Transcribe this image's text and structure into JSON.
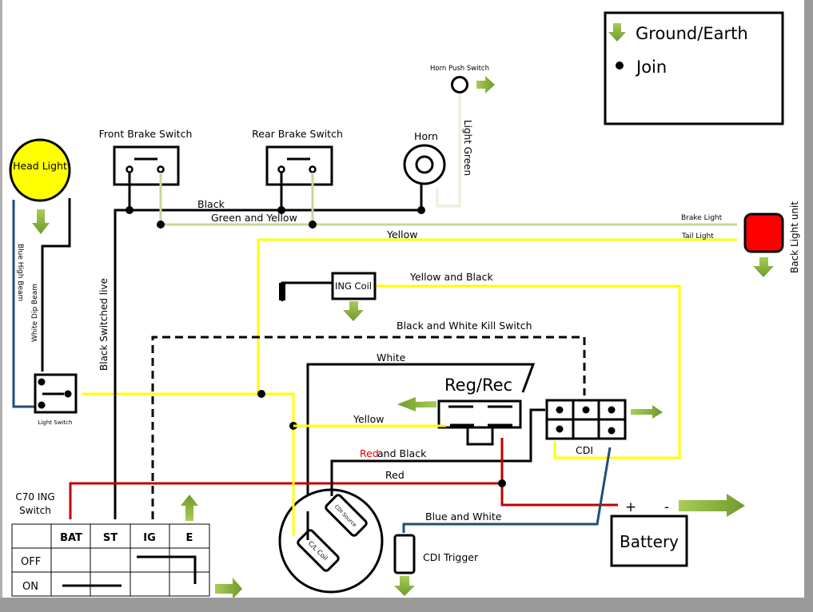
{
  "legend": {
    "items": [
      {
        "icon": "ground-arrow-icon",
        "label": "Ground/Earth"
      },
      {
        "icon": "join-dot-icon",
        "label": "Join"
      }
    ]
  },
  "components": {
    "head_light": "Head Light",
    "light_switch": "Light Switch",
    "front_brake_switch": "Front Brake Switch",
    "rear_brake_switch": "Rear Brake Switch",
    "horn": "Horn",
    "horn_push_switch": "Horn Push Switch",
    "back_light_unit": "Back Light unit",
    "ing_coil": "ING Coil",
    "reg_rec": "Reg/Rec",
    "cdi": "CDI",
    "battery": "Battery",
    "battery_plus": "+",
    "battery_minus": "-",
    "cdi_trigger": "CDI Trigger",
    "cl_coil": "C/L Coil",
    "cdi_source": "CDI Source",
    "ign_switch": "C70 ING Switch",
    "ign_switch_line1": "C70 ING",
    "ign_switch_line2": "Switch"
  },
  "wires": {
    "blue_high_beam": "Blue High Beam",
    "white_dip_beam": "White Dip Beam",
    "black_switched_live": "Black Switched live",
    "black": "Black",
    "green_and_yellow": "Green and Yellow",
    "light_green": "Light Green",
    "brake_light": "Brake Light",
    "tail_light": "Tail Light",
    "yellow_top": "Yellow",
    "yellow_and_black": "Yellow and Black",
    "kill_switch": "Black and White Kill Switch",
    "white": "White",
    "yellow_mid": "Yellow",
    "red_and_black_red": "Red",
    "red_and_black_rest": " and Black",
    "red": "Red",
    "blue_and_white": "Blue and White"
  },
  "ign_table": {
    "headers": [
      "",
      "BAT",
      "ST",
      "IG",
      "E"
    ],
    "rows": [
      {
        "label": "OFF",
        "connection": "IG-E"
      },
      {
        "label": "ON",
        "connection": "BAT-ST"
      }
    ]
  },
  "colors": {
    "yellow_wire": "#ffff00",
    "red_wire": "#c00000",
    "blue_wire": "#1f4e79",
    "green_wire": "#c4d79b",
    "light_green_wire": "#ebf1de",
    "ground_arrow": "#8db33a",
    "head_light_fill": "#ffff00",
    "back_light_fill": "#ff0000"
  }
}
